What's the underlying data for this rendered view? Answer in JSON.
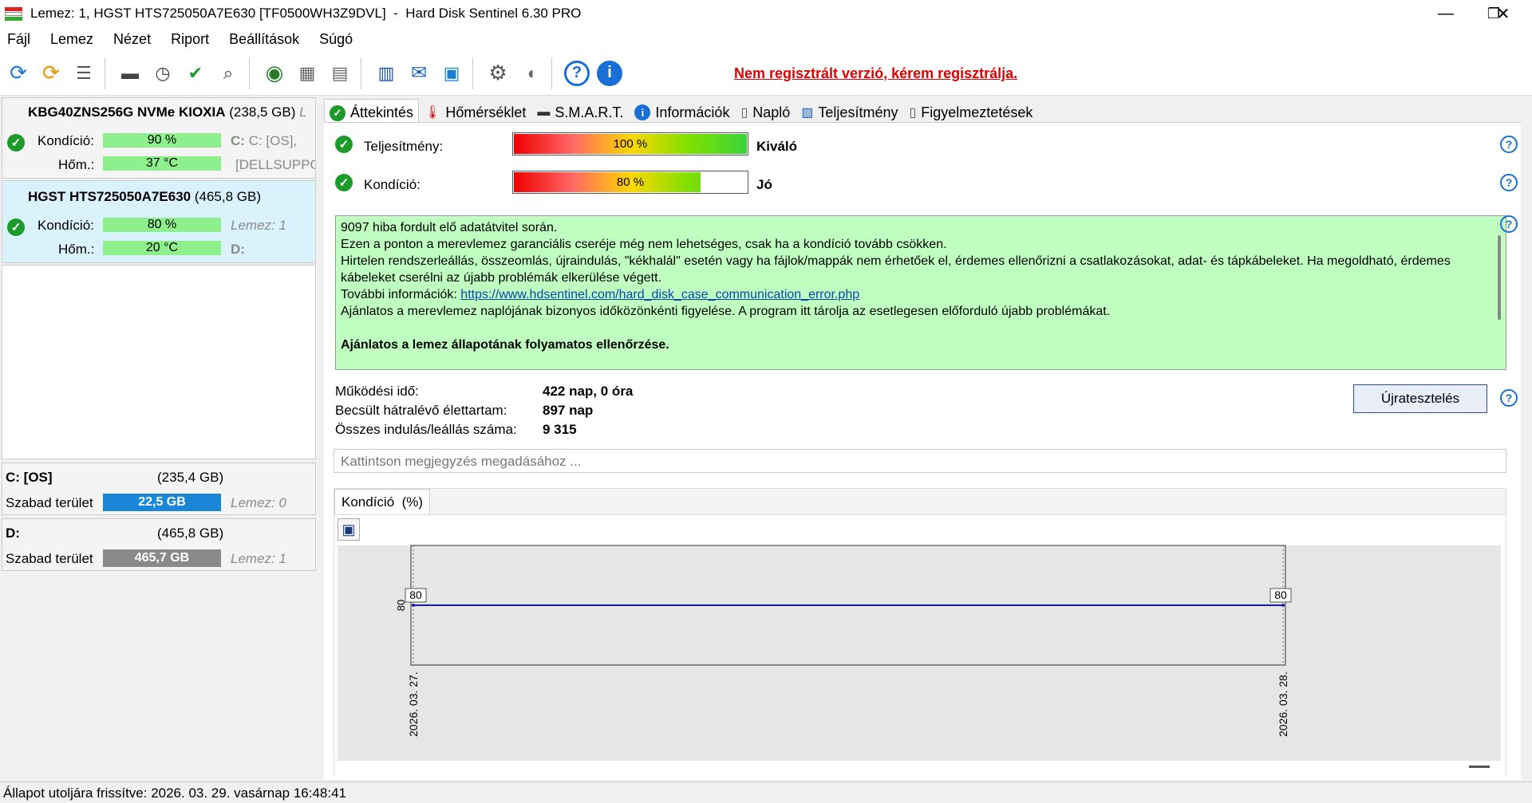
{
  "window": {
    "title": "Lemez: 1, HGST HTS725050A7E630 [TF0500WH3Z9DVL]  -  Hard Disk Sentinel 6.30 PRO",
    "minimize": "—",
    "maximize": "❐",
    "close": "✕"
  },
  "menu": [
    "Fájl",
    "Lemez",
    "Nézet",
    "Riport",
    "Beállítások",
    "Súgó"
  ],
  "toolbar": {
    "register_text": "Nem regisztrált verzió, kérem regisztrálja.",
    "icons": [
      "refresh-icon",
      "refresh-warning-icon",
      "disk-list-icon",
      "disk-surface-icon",
      "disk-schedule-icon",
      "disk-ok-icon",
      "disk-search-icon",
      "globe-icon",
      "network-disks-icon",
      "backup-icon",
      "report-icon",
      "mail-icon",
      "network-monitor-icon",
      "settings-icon",
      "sound-icon",
      "help-icon",
      "info-icon"
    ]
  },
  "disks": [
    {
      "name": "KBG40ZNS256G NVMe KIOXIA",
      "size": "(238,5 GB)",
      "size_suffix": "L",
      "kond_label": "Kondíció:",
      "kond_value": "90 %",
      "kond_pct": 90,
      "hom_label": "Hőm.:",
      "hom_value": "37 °C",
      "info1": "C: [OS],",
      "info2": "[DELLSUPPOR"
    },
    {
      "name": "HGST HTS725050A7E630",
      "size": "(465,8 GB)",
      "kond_label": "Kondíció:",
      "kond_value": "80 %",
      "kond_pct": 80,
      "hom_label": "Hőm.:",
      "hom_value": "20 °C",
      "info1": "Lemez: 1",
      "info2": "D:"
    }
  ],
  "volumes": [
    {
      "name": "C: [OS]",
      "size": "(235,4 GB)",
      "free_label": "Szabad terület",
      "free_value": "22,5 GB",
      "disk": "Lemez: 0",
      "color": "#1a86d8"
    },
    {
      "name": "D:",
      "size": "(465,8 GB)",
      "free_label": "Szabad terület",
      "free_value": "465,7 GB",
      "disk": "Lemez: 1",
      "color": "#8a8a8a"
    }
  ],
  "tabs": [
    {
      "label": "Áttekintés",
      "icon": "check-icon"
    },
    {
      "label": "Hőmérséklet",
      "icon": "thermometer-icon"
    },
    {
      "label": "S.M.A.R.T.",
      "icon": "smart-icon"
    },
    {
      "label": "Információk",
      "icon": "info-icon"
    },
    {
      "label": "Napló",
      "icon": "log-icon"
    },
    {
      "label": "Teljesítmény",
      "icon": "performance-icon"
    },
    {
      "label": "Figyelmeztetések",
      "icon": "alerts-icon"
    }
  ],
  "overview": {
    "perf_label": "Teljesítmény:",
    "perf_value": "100 %",
    "perf_pct": 100,
    "perf_rating": "Kiváló",
    "kond_label": "Kondíció:",
    "kond_value": "80 %",
    "kond_pct": 80,
    "kond_rating": "Jó",
    "message": {
      "line1": "9097 hiba fordult elő adatátvitel során.",
      "line2": "Ezen a ponton a merevlemez garanciális cseréje még nem lehetséges, csak ha a kondíció tovább csökken.",
      "line3": "Hirtelen rendszerleállás, összeomlás, újraindulás, \"kékhalál\" esetén vagy ha fájlok/mappák nem érhetőek el, érdemes ellenőrizni a csatlakozásokat, adat- és tápkábeleket. Ha megoldható, érdemes kábeleket cserélni az újabb problémák elkerülése végett.",
      "line4_prefix": "További információk: ",
      "link": "https://www.hdsentinel.com/hard_disk_case_communication_error.php",
      "line5": "Ajánlatos a merevlemez naplójának bizonyos időközönkénti figyelése. A program itt tárolja az esetlegesen előforduló újabb problémákat.",
      "bold": "Ajánlatos a lemez állapotának folyamatos ellenőrzése."
    },
    "uptime_label": "Működési idő:",
    "uptime_value": "422 nap, 0 óra",
    "life_label": "Becsült hátralévő élettartam:",
    "life_value": "897 nap",
    "starts_label": "Összes indulás/leállás száma:",
    "starts_value": "9 315",
    "retest_button": "Újratesztelés",
    "note_placeholder": "Kattintson megjegyzés megadásához ..."
  },
  "chart_data": {
    "type": "line",
    "title": "Kondíció  (%)",
    "x": [
      "2026. 03. 27.",
      "2026. 03. 28."
    ],
    "series": [
      {
        "values": [
          80,
          80
        ]
      }
    ],
    "ytick": "80",
    "ylim": [
      0,
      100
    ],
    "color": "#1a1aa8"
  },
  "status": "Állapot utoljára frissítve: 2026. 03. 29. vasárnap 16:48:41"
}
